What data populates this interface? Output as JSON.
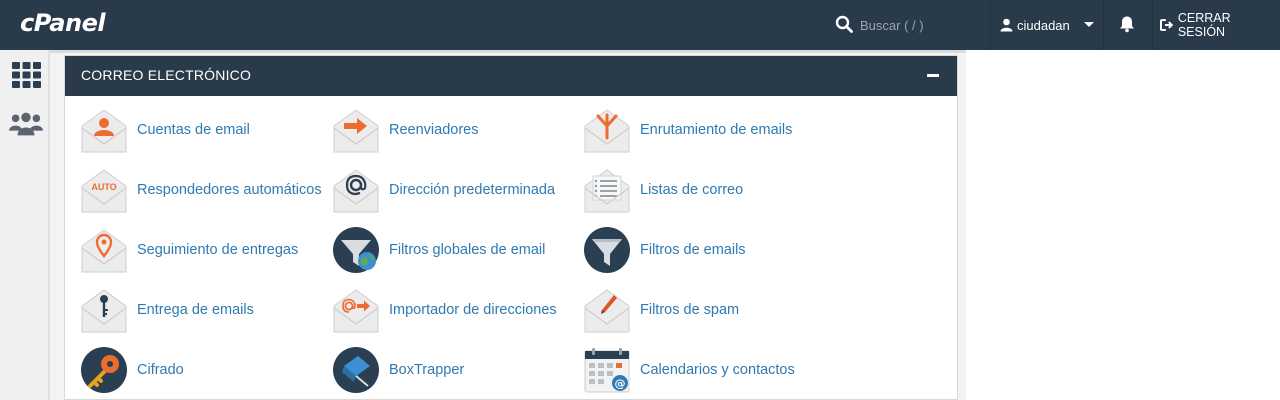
{
  "header": {
    "logo": "cPanel",
    "search_placeholder": "Buscar ( / )",
    "username": "ciudadan",
    "logout_label": "CERRAR SESIÓN"
  },
  "sidebar": {
    "items": [
      {
        "icon": "grid-icon"
      },
      {
        "icon": "users-icon"
      }
    ]
  },
  "section": {
    "title": "CORREO ELECTRÓNICO",
    "items": [
      {
        "label": "Cuentas de email",
        "icon": "email-accounts-icon"
      },
      {
        "label": "Reenviadores",
        "icon": "forwarders-icon"
      },
      {
        "label": "Enrutamiento de emails",
        "icon": "email-routing-icon"
      },
      {
        "label": "Respondedores automáticos",
        "icon": "autoresponders-icon"
      },
      {
        "label": "Dirección predeterminada",
        "icon": "default-address-icon"
      },
      {
        "label": "Listas de correo",
        "icon": "mailing-lists-icon"
      },
      {
        "label": "Seguimiento de entregas",
        "icon": "track-delivery-icon"
      },
      {
        "label": "Filtros globales de email",
        "icon": "global-filters-icon"
      },
      {
        "label": "Filtros de emails",
        "icon": "email-filters-icon"
      },
      {
        "label": "Entrega de emails",
        "icon": "email-deliverability-icon"
      },
      {
        "label": "Importador de direcciones",
        "icon": "address-importer-icon"
      },
      {
        "label": "Filtros de spam",
        "icon": "spam-filters-icon"
      },
      {
        "label": "Cifrado",
        "icon": "encryption-icon"
      },
      {
        "label": "BoxTrapper",
        "icon": "boxtrapper-icon"
      },
      {
        "label": "Calendarios y contactos",
        "icon": "calendars-contacts-icon"
      }
    ],
    "auto_badge": "AUTO"
  },
  "colors": {
    "topbar": "#293a4a",
    "link": "#2e7ab3",
    "accent_orange": "#ef6c2f"
  }
}
